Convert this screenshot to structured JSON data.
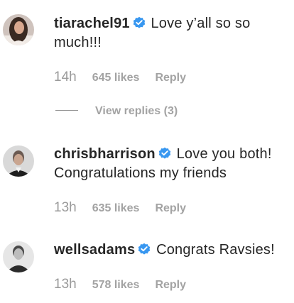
{
  "comments": [
    {
      "username": "tiarachel91",
      "text": "Love y’all so so much!!!",
      "time": "14h",
      "likes": "645 likes",
      "reply_label": "Reply",
      "view_replies": "View replies (3)",
      "verified": true
    },
    {
      "username": "chrisbharrison",
      "text": "Love you both! Congratulations my friends",
      "time": "13h",
      "likes": "635 likes",
      "reply_label": "Reply",
      "verified": true
    },
    {
      "username": "wellsadams",
      "text": "Congrats Ravsies!",
      "time": "13h",
      "likes": "578 likes",
      "reply_label": "Reply",
      "verified": true
    }
  ],
  "colors": {
    "text": "#262626",
    "muted": "#a3a3a3",
    "verified_badge": "#3897f0"
  },
  "icons": {
    "verified": "verified-badge-icon"
  }
}
